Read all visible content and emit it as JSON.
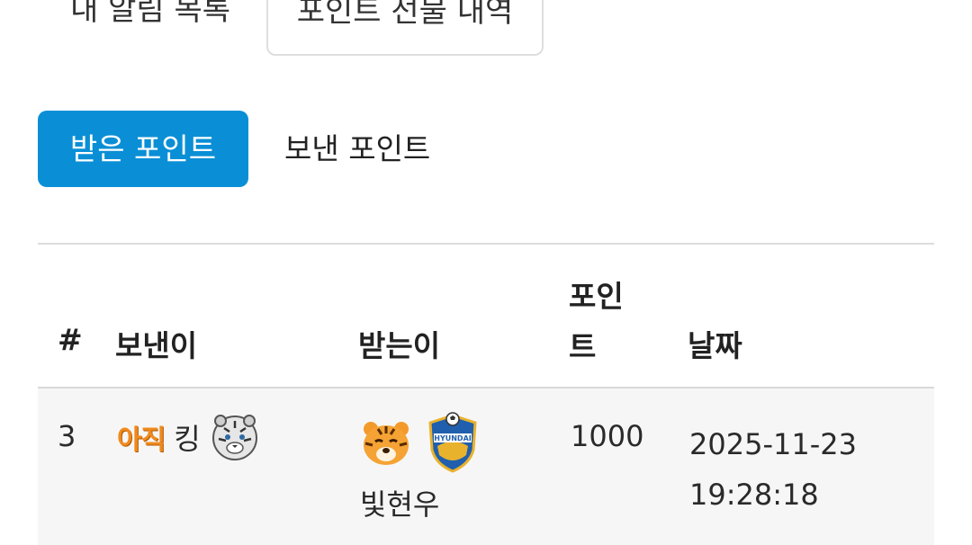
{
  "top_tabs": {
    "alerts_label": "내 알림 목록",
    "gifts_label": "포인트 선물 내역"
  },
  "sub_tabs": {
    "received_label": "받은 포인트",
    "sent_label": "보낸 포인트"
  },
  "table": {
    "headers": {
      "num": "#",
      "sender": "보낸이",
      "receiver": "받는이",
      "points": "포인트",
      "date": "날짜"
    },
    "rows": [
      {
        "num": "3",
        "sender_badge": "아직",
        "sender_name": "킹",
        "sender_icon": "white-tiger-icon",
        "receiver_icons": [
          "tiger-face-icon",
          "ulsan-hyundai-emblem-icon"
        ],
        "receiver_name": "빛현우",
        "points": "1000",
        "date": "2025-11-23",
        "time": "19:28:18"
      }
    ]
  },
  "colors": {
    "accent": "#0a8fd6",
    "row_bg": "#f6f6f6",
    "badge": "#f08a1e"
  }
}
